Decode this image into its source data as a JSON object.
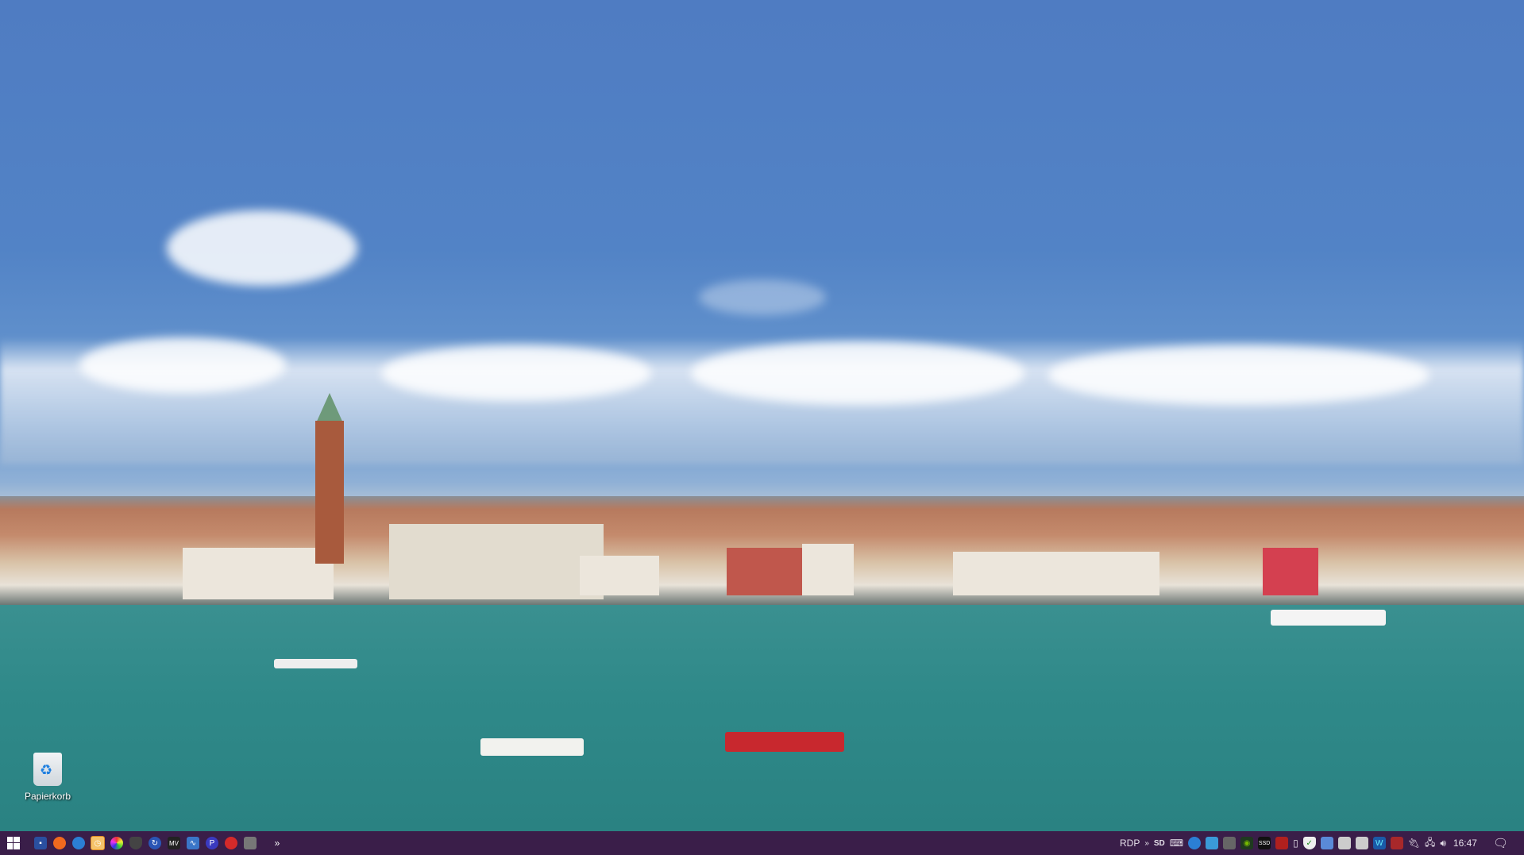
{
  "desktop": {
    "icons": [
      {
        "label": "Papierkorb",
        "icon": "recycle-bin-icon"
      }
    ]
  },
  "taskbar": {
    "start": "windows-start-icon",
    "pinned": [
      "floppy-64-icon",
      "firefox-icon",
      "thunderbird-icon",
      "clock-app-icon",
      "file-fabric-icon",
      "shield-app-icon",
      "sync-app-icon",
      "mv-video-icon",
      "waveform-monitor-icon",
      "p-app-icon",
      "red-app-icon",
      "printer-tool-icon"
    ],
    "overflow": "»",
    "tray": {
      "rdp": "RDP",
      "overflow": "»",
      "sd_label": "SD",
      "ssd_label": "SSD",
      "icons": [
        "sd-card-icon",
        "keyboard-icon",
        "thunderbird-tray-icon",
        "network-app-icon",
        "display-icon",
        "nvidia-icon",
        "ssd-icon",
        "red-triangle-icon",
        "usb-icon",
        "defender-icon",
        "remote-desktop-icon",
        "printer-icon",
        "printer2-icon",
        "wave-app-icon",
        "red-tray-app-icon",
        "power-icon",
        "network-icon",
        "volume-icon"
      ],
      "clock": "16:47",
      "notification": "notification-icon"
    }
  },
  "colors": {
    "taskbar": "#3a1e49",
    "sky": "#5283c6",
    "water": "#2f8989"
  }
}
